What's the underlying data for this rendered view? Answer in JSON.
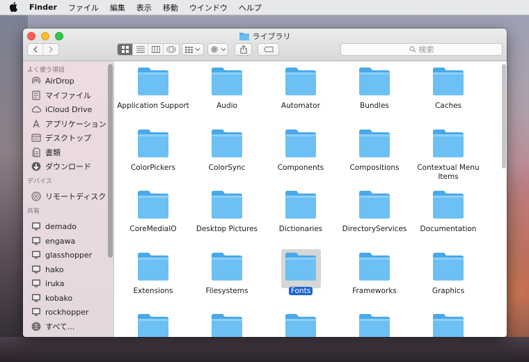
{
  "menubar": {
    "app_name": "Finder",
    "items": [
      "ファイル",
      "編集",
      "表示",
      "移動",
      "ウインドウ",
      "ヘルプ"
    ]
  },
  "window": {
    "title": "ライブラリ",
    "search_placeholder": "検索"
  },
  "sidebar": {
    "favorites_header": "よく使う項目",
    "favorites": [
      {
        "label": "AirDrop",
        "icon": "airdrop-icon"
      },
      {
        "label": "マイファイル",
        "icon": "all-my-files-icon"
      },
      {
        "label": "iCloud Drive",
        "icon": "cloud-icon"
      },
      {
        "label": "アプリケーション",
        "icon": "applications-icon"
      },
      {
        "label": "デスクトップ",
        "icon": "desktop-icon"
      },
      {
        "label": "書類",
        "icon": "documents-icon"
      },
      {
        "label": "ダウンロード",
        "icon": "downloads-icon"
      }
    ],
    "devices_header": "デバイス",
    "devices": [
      {
        "label": "リモートディスク",
        "icon": "remote-disc-icon"
      }
    ],
    "shared_header": "共有",
    "shared": [
      {
        "label": "demado",
        "icon": "display-icon"
      },
      {
        "label": "engawa",
        "icon": "display-icon"
      },
      {
        "label": "glasshopper",
        "icon": "display-icon"
      },
      {
        "label": "hako",
        "icon": "display-icon"
      },
      {
        "label": "iruka",
        "icon": "display-icon"
      },
      {
        "label": "kobako",
        "icon": "display-icon"
      },
      {
        "label": "rockhopper",
        "icon": "display-icon"
      },
      {
        "label": "すべて...",
        "icon": "network-icon"
      }
    ]
  },
  "folders": [
    "Application Support",
    "Audio",
    "Automator",
    "Bundles",
    "Caches",
    "ColorPickers",
    "ColorSync",
    "Components",
    "Compositions",
    "Contextual Menu Items",
    "CoreMediaIO",
    "Desktop Pictures",
    "Dictionaries",
    "DirectoryServices",
    "Documentation",
    "Extensions",
    "Filesystems",
    "Fonts",
    "Frameworks",
    "Graphics",
    "",
    "",
    "",
    "",
    ""
  ],
  "selected_folder": "Fonts",
  "colors": {
    "folder": "#5ab7f0",
    "selection": "#1b63d6"
  }
}
